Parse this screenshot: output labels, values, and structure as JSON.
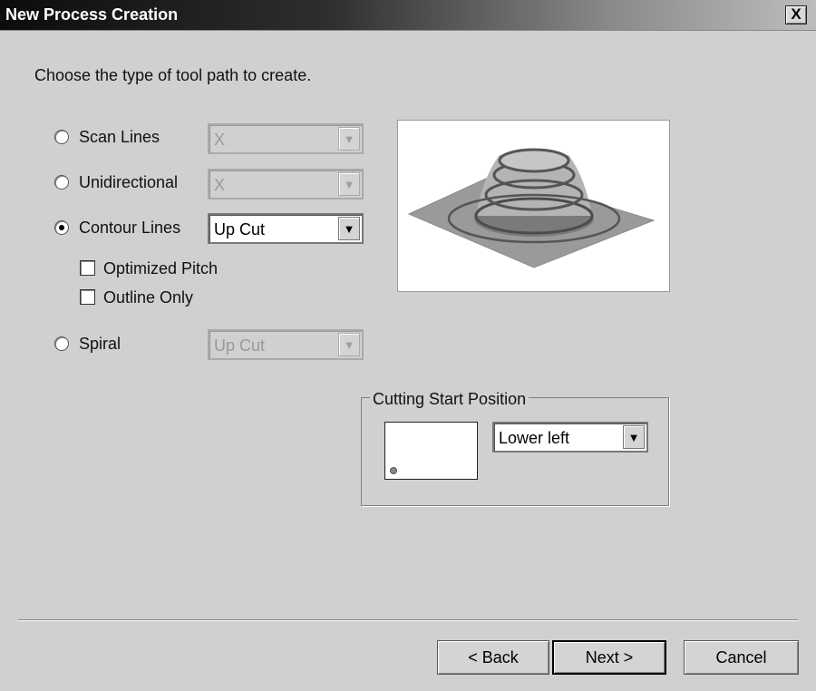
{
  "window": {
    "title": "New Process Creation",
    "close_label": "X"
  },
  "prompt": "Choose the type of tool path to create.",
  "options": {
    "scan_lines": {
      "label": "Scan Lines",
      "selected": false,
      "combo_value": "X",
      "enabled": false
    },
    "unidirectional": {
      "label": "Unidirectional",
      "selected": false,
      "combo_value": "X",
      "enabled": false
    },
    "contour_lines": {
      "label": "Contour Lines",
      "selected": true,
      "combo_value": "Up Cut",
      "enabled": true
    },
    "spiral": {
      "label": "Spiral",
      "selected": false,
      "combo_value": "Up Cut",
      "enabled": false
    }
  },
  "checkboxes": {
    "optimized_pitch": {
      "label": "Optimized Pitch",
      "checked": false
    },
    "outline_only": {
      "label": "Outline Only",
      "checked": false
    }
  },
  "cutting_start": {
    "group_label": "Cutting Start Position",
    "value": "Lower left"
  },
  "buttons": {
    "back": "< Back",
    "next": "Next >",
    "cancel": "Cancel"
  },
  "icons": {
    "combo_arrow": "chevron-down-icon",
    "preview": "contour-toolpath-preview"
  }
}
